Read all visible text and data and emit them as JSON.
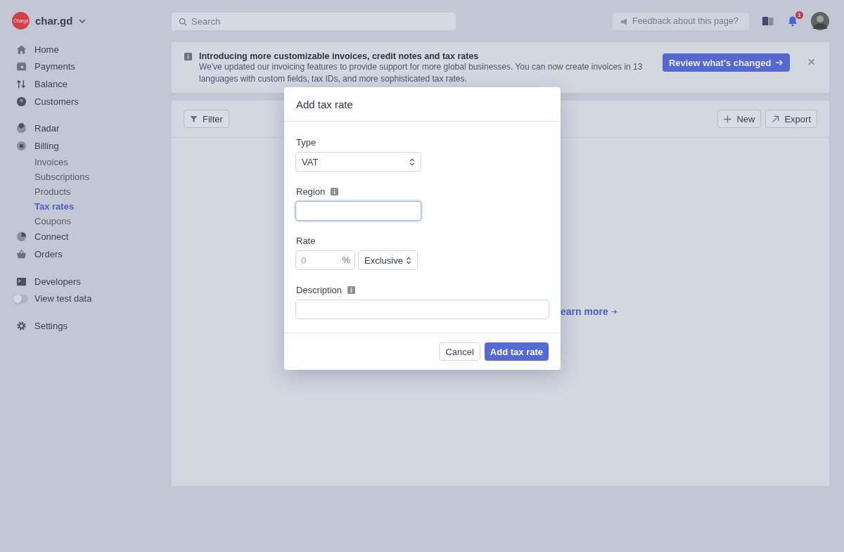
{
  "account": {
    "logo_text": "Chargd",
    "name": "char.gd"
  },
  "sidebar": {
    "groups": [
      {
        "items": [
          {
            "kind": "link",
            "label": "Home",
            "selected": false
          },
          {
            "kind": "link",
            "label": "Payments",
            "selected": false
          },
          {
            "kind": "link",
            "label": "Balance",
            "selected": false
          },
          {
            "kind": "link",
            "label": "Customers",
            "selected": false
          }
        ]
      },
      {
        "items": [
          {
            "kind": "link",
            "label": "Radar",
            "selected": false
          },
          {
            "kind": "link",
            "label": "Billing",
            "selected": false,
            "children": [
              {
                "label": "Invoices",
                "selected": false
              },
              {
                "label": "Subscriptions",
                "selected": false
              },
              {
                "label": "Products",
                "selected": false
              },
              {
                "label": "Tax rates",
                "selected": true
              },
              {
                "label": "Coupons",
                "selected": false
              }
            ]
          },
          {
            "kind": "link",
            "label": "Connect",
            "selected": false
          },
          {
            "kind": "link",
            "label": "Orders",
            "selected": false
          }
        ]
      },
      {
        "items": [
          {
            "kind": "link",
            "label": "Developers",
            "selected": false
          },
          {
            "kind": "toggle",
            "label": "View test data",
            "on": false
          }
        ]
      },
      {
        "items": [
          {
            "kind": "link",
            "label": "Settings",
            "selected": false
          }
        ]
      }
    ]
  },
  "search": {
    "placeholder": "Search"
  },
  "header": {
    "feedback_placeholder": "Feedback about this page?",
    "notification_count": "1"
  },
  "banner": {
    "title": "Introducing more customizable invoices, credit notes and tax rates",
    "body_lines": [
      "We've updated our invoicing features to provide support for more global businesses. You can now create invoices in 13",
      "languages with custom fields, tax IDs, and more sophisticated tax rates."
    ],
    "button": "Review what's changed"
  },
  "toolbar": {
    "filter": "Filter",
    "new": "New",
    "export": "Export"
  },
  "empty_state": {
    "link": "earn more"
  },
  "dialog": {
    "title": "Add tax rate",
    "type": {
      "label": "Type",
      "value": "VAT"
    },
    "region": {
      "label": "Region",
      "focused": true
    },
    "rate": {
      "label": "Rate",
      "placeholder": "0",
      "unit": "%",
      "mode": "Exclusive"
    },
    "description": {
      "label": "Description"
    },
    "buttons": [
      {
        "kind": "secondary",
        "label": "Cancel"
      },
      {
        "kind": "primary",
        "label": "Add tax rate"
      }
    ]
  }
}
